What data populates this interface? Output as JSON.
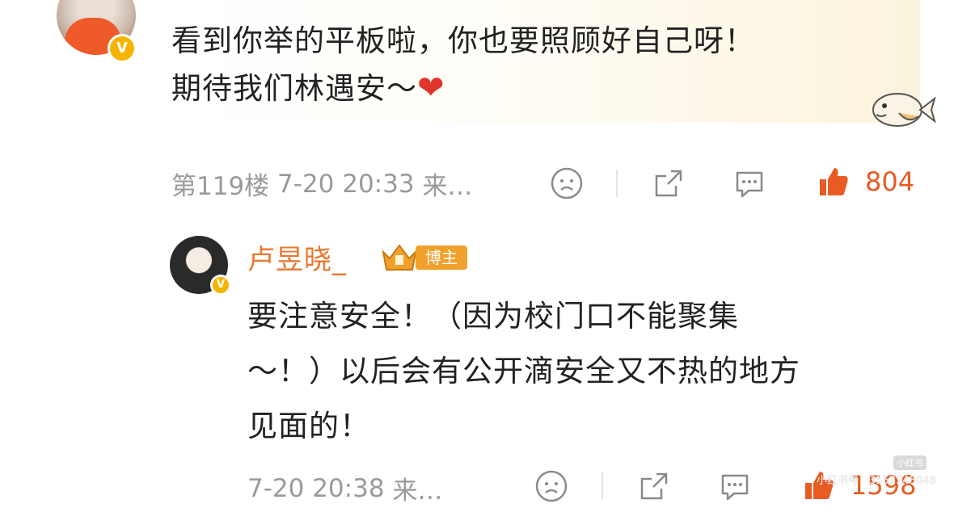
{
  "top_comment": {
    "text_line1": "看到你举的平板啦，你也要照顾好自己呀！",
    "text_line2": "期待我们林遇安～",
    "heart": "❤",
    "floor": "第119楼",
    "time": "7-20 20:33",
    "source": "来…",
    "likes": "804"
  },
  "reply": {
    "author": "卢昱晓_",
    "badge": "博主",
    "text_line1": "要注意安全！（因为校门口不能聚集",
    "text_line2": "～！）以后会有公开滴安全又不热的地方",
    "text_line3": "见面的！",
    "time": "7-20 20:38",
    "source": "来…",
    "likes": "1598"
  },
  "watermark": {
    "text": "小红书号：3552345048",
    "logo": "小红书"
  },
  "icons": [
    "dislike-face-icon",
    "share-icon",
    "comment-icon",
    "thumbs-up-icon",
    "verified-v-icon",
    "crown-icon"
  ],
  "colors": {
    "accent": "#e85b22",
    "author": "#e8772e",
    "meta": "#9a9a9a",
    "verified": "#f6b400"
  }
}
